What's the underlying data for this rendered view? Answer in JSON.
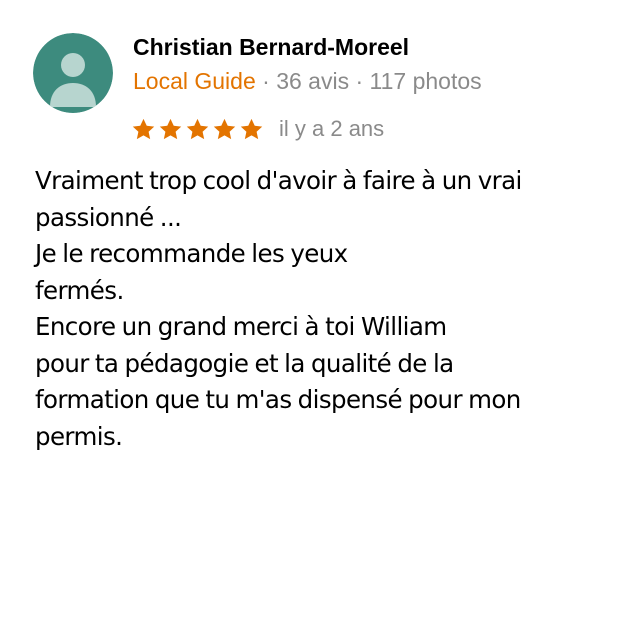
{
  "review": {
    "author_name": "Christian Bernard-Moreel",
    "badge": "Local Guide",
    "separator": " · ",
    "reviews_count": "36 avis",
    "photos_count": "117 photos",
    "rating": 5,
    "rating_max": 5,
    "date": "il y a 2 ans",
    "text": "Vraiment trop cool d'avoir à faire à un vrai\npassionné ...\nJe le recommande les yeux\nfermés.\nEncore un grand merci à toi William\npour ta pédagogie et la qualité de la\nformation que tu m'as dispensé pour mon\npermis."
  },
  "colors": {
    "avatar_background": "#3d8b7e",
    "avatar_figure": "#b7d5cf",
    "local_guide": "#e37400",
    "star": "#e37400",
    "meta_text": "#8a8a8a",
    "body_text": "#000000"
  },
  "icons": {
    "avatar": "person-silhouette-icon",
    "star": "star-icon"
  }
}
